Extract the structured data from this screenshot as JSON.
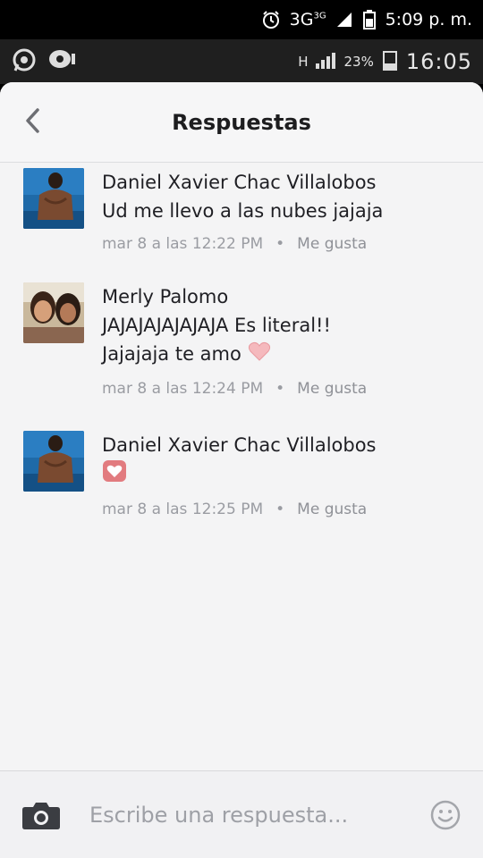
{
  "outer_status": {
    "network": "3G",
    "network_sup": "3G",
    "time": "5:09 p. m."
  },
  "inner_status": {
    "signal_type": "H",
    "battery": "23%",
    "clock": "16:05"
  },
  "header": {
    "title": "Respuestas"
  },
  "comments": [
    {
      "author": "Daniel Xavier Chac Villalobos",
      "lines": [
        "Ud me llevo a las nubes jajaja"
      ],
      "time": "mar 8 a las 12:22 PM",
      "like": "Me gusta"
    },
    {
      "author": "Merly Palomo",
      "lines": [
        "JAJAJAJAJAJAJA Es literal!!",
        "Jajajaja te amo"
      ],
      "time": "mar 8 a las 12:24 PM",
      "like": "Me gusta"
    },
    {
      "author": "Daniel Xavier Chac Villalobos",
      "lines": [],
      "time": "mar 8 a las 12:25 PM",
      "like": "Me gusta"
    }
  ],
  "separator": "•",
  "composer": {
    "placeholder": "Escribe una respuesta..."
  },
  "colors": {
    "background": "#f4f4f5",
    "text": "#1f1f24",
    "meta": "#9a9ca2",
    "heart": "#e07a7a"
  }
}
